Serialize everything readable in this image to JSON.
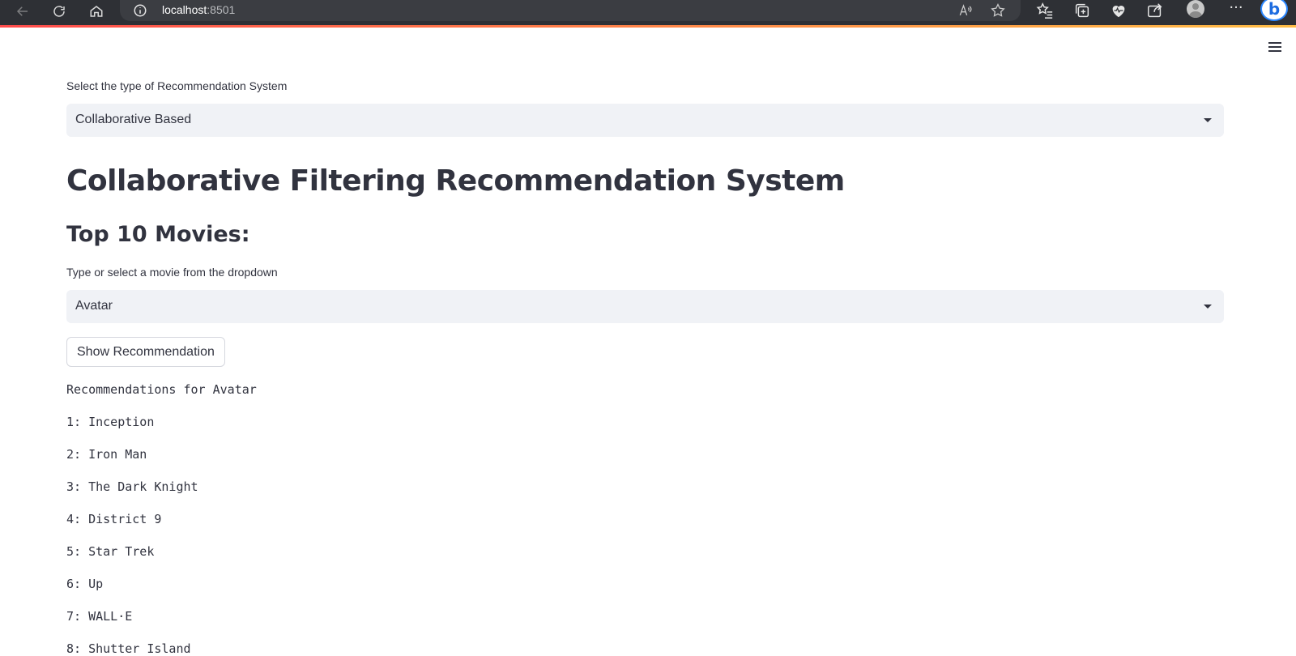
{
  "browser": {
    "address_host": "localhost",
    "address_port": ":8501"
  },
  "app": {
    "system_select": {
      "label": "Select the type of Recommendation System",
      "selected": "Collaborative Based"
    },
    "title": "Collaborative Filtering Recommendation System",
    "subtitle": "Top 10 Movies:",
    "movie_select": {
      "label": "Type or select a movie from the dropdown",
      "selected": "Avatar"
    },
    "show_button": "Show Recommendation",
    "results_heading": "Recommendations for Avatar",
    "results": [
      "1: Inception",
      "2: Iron Man",
      "3: The Dark Knight",
      "4: District 9",
      "5: Star Trek",
      "6: Up",
      "7: WALL·E",
      "8: Shutter Island"
    ]
  }
}
